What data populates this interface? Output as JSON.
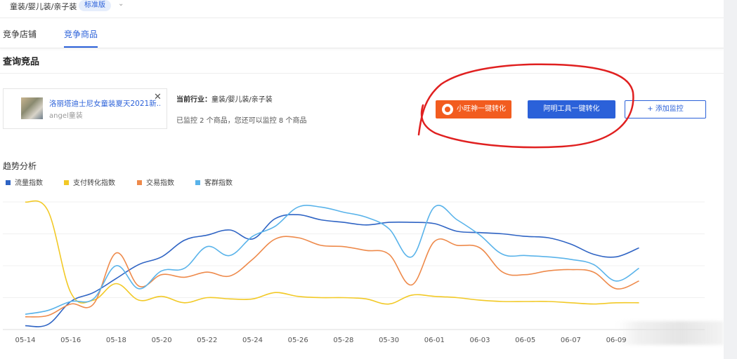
{
  "category": {
    "path": "童装/婴儿装/亲子装",
    "badge": "标准版"
  },
  "tabs": [
    {
      "label": "竞争店铺"
    },
    {
      "label": "竞争商品"
    }
  ],
  "section_title": "查询竞品",
  "product": {
    "title": "洛丽塔迪士尼女童装夏天2021新...",
    "shop": "angel童装"
  },
  "industry": {
    "label": "当前行业：",
    "value": "童装/婴儿装/亲子装"
  },
  "monitor_note": "已监控 2 个商品，您还可以监控 8 个商品",
  "buttons": {
    "xiaowang": "小旺神一键转化",
    "ali_tool": "阿明工具一键转化",
    "add_monitor": "+ 添加监控"
  },
  "trend_title": "趋势分析",
  "colors": {
    "blue": "#2b61d9",
    "orange_btn": "#f25c1f",
    "annotation": "#e02020"
  },
  "chart_data": {
    "type": "line",
    "x": [
      "05-14",
      "05-15",
      "05-16",
      "05-17",
      "05-18",
      "05-19",
      "05-20",
      "05-21",
      "05-22",
      "05-23",
      "05-24",
      "05-25",
      "05-26",
      "05-27",
      "05-28",
      "05-29",
      "05-30",
      "05-31",
      "06-01",
      "06-02",
      "06-03",
      "06-04",
      "06-05",
      "06-06",
      "06-07",
      "06-08",
      "06-09",
      "06-10"
    ],
    "tick_labels": [
      "05-14",
      "05-16",
      "05-18",
      "05-20",
      "05-22",
      "05-24",
      "05-26",
      "05-28",
      "05-30",
      "06-01",
      "06-03",
      "06-05",
      "06-07",
      "06-09"
    ],
    "ylim": [
      0,
      100
    ],
    "grid": true,
    "legend_position": "top-left",
    "series": [
      {
        "name": "流量指数",
        "color": "#2f64c4",
        "values": [
          3,
          4,
          22,
          29,
          40,
          51,
          57,
          70,
          74,
          78,
          71,
          87,
          90,
          86,
          84,
          82,
          84,
          84,
          83,
          77,
          76,
          75,
          73,
          72,
          67,
          59,
          57,
          64
        ]
      },
      {
        "name": "支付转化指数",
        "color": "#f2c926",
        "values": [
          100,
          93,
          29,
          23,
          36,
          23,
          26,
          21,
          25,
          24,
          24,
          29,
          26,
          25,
          25,
          24,
          20,
          27,
          26,
          25,
          23,
          22,
          22,
          22,
          21,
          20,
          21,
          21
        ]
      },
      {
        "name": "交易指数",
        "color": "#ee8a4b",
        "values": [
          10,
          11,
          20,
          20,
          60,
          34,
          43,
          41,
          45,
          42,
          55,
          71,
          72,
          66,
          65,
          62,
          59,
          35,
          69,
          66,
          64,
          45,
          43,
          46,
          47,
          45,
          32,
          38
        ]
      },
      {
        "name": "客群指数",
        "color": "#59b3ea",
        "values": [
          12,
          15,
          22,
          24,
          50,
          32,
          46,
          48,
          65,
          58,
          73,
          81,
          96,
          96,
          92,
          88,
          79,
          57,
          96,
          86,
          74,
          59,
          58,
          57,
          55,
          51,
          38,
          48
        ]
      }
    ]
  }
}
